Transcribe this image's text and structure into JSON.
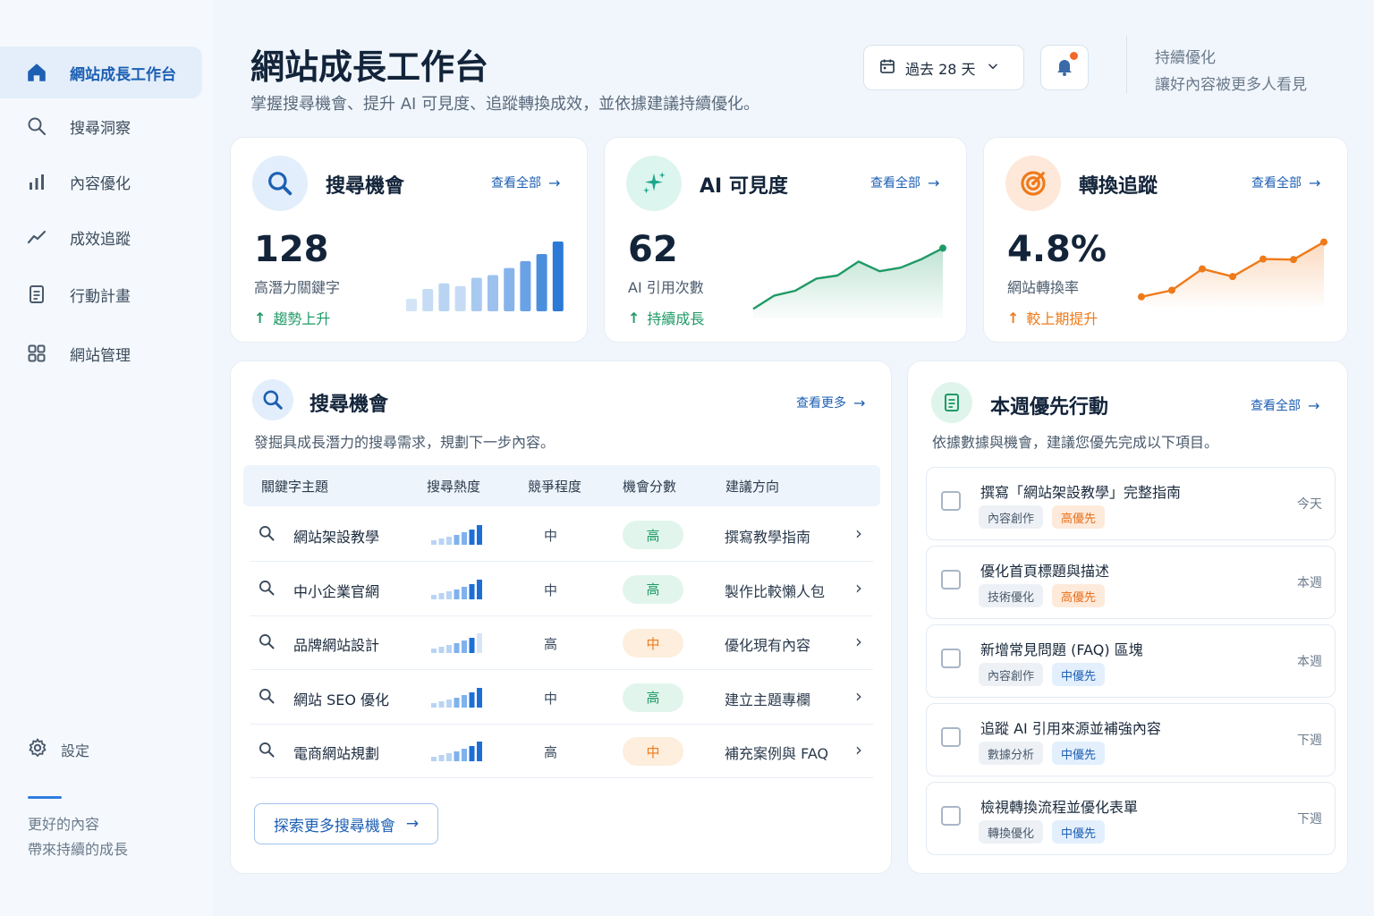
{
  "sidebar": {
    "items": [
      {
        "label": "網站成長工作台",
        "icon": "home-icon",
        "active": true
      },
      {
        "label": "搜尋洞察",
        "icon": "search-icon"
      },
      {
        "label": "內容優化",
        "icon": "bar-chart-icon"
      },
      {
        "label": "成效追蹤",
        "icon": "trend-line-icon"
      },
      {
        "label": "行動計畫",
        "icon": "document-icon"
      },
      {
        "label": "網站管理",
        "icon": "grid-icon"
      }
    ],
    "settings_label": "設定",
    "tagline_line1": "更好的內容",
    "tagline_line2": "帶來持續的成長"
  },
  "header": {
    "title": "網站成長工作台",
    "subtitle": "掌握搜尋機會、提升 AI 可見度、追蹤轉換成效，並依據建議持續優化。",
    "date_range": "過去 28 天",
    "note_line1": "持續優化",
    "note_line2": "讓好內容被更多人看見"
  },
  "colors": {
    "brand": "#1d5fb3",
    "accent_blue": "#2f7de0",
    "green": "#1f9a66",
    "orange": "#ef7a1a"
  },
  "kpis": [
    {
      "title": "搜尋機會",
      "view_all": "查看全部",
      "value": "128",
      "label": "高潛力關鍵字",
      "trend": "趨勢上升",
      "icon": "search-icon",
      "bars": [
        0.18,
        0.32,
        0.4,
        0.36,
        0.48,
        0.52,
        0.62,
        0.72,
        0.82,
        1.0
      ]
    },
    {
      "title": "AI 可見度",
      "view_all": "查看全部",
      "value": "62",
      "label": "AI 引用次數",
      "trend": "持續成長",
      "icon": "sparkle-icon",
      "series": [
        0.0,
        0.22,
        0.3,
        0.5,
        0.55,
        0.78,
        0.62,
        0.68,
        0.82,
        1.0
      ]
    },
    {
      "title": "轉換追蹤",
      "view_all": "查看全部",
      "value": "4.8%",
      "label": "網站轉換率",
      "trend": "較上期提升",
      "icon": "target-icon",
      "series": [
        0.0,
        0.12,
        0.51,
        0.37,
        0.69,
        0.68,
        1.0
      ]
    }
  ],
  "search": {
    "title": "搜尋機會",
    "view_more": "查看更多",
    "desc": "發掘具成長潛力的搜尋需求，規劃下一步內容。",
    "columns": [
      "關鍵字主題",
      "搜尋熱度",
      "競爭程度",
      "機會分數",
      "建議方向"
    ],
    "rows": [
      {
        "keyword": "網站架設教學",
        "heat": 5,
        "competition": "中",
        "score": "高",
        "score_level": "high",
        "suggestion": "撰寫教學指南"
      },
      {
        "keyword": "中小企業官網",
        "heat": 5,
        "competition": "中",
        "score": "高",
        "score_level": "high",
        "suggestion": "製作比較懶人包"
      },
      {
        "keyword": "品牌網站設計",
        "heat": 4,
        "competition": "高",
        "score": "中",
        "score_level": "mid",
        "suggestion": "優化現有內容"
      },
      {
        "keyword": "網站 SEO 優化",
        "heat": 5,
        "competition": "中",
        "score": "高",
        "score_level": "high",
        "suggestion": "建立主題專欄"
      },
      {
        "keyword": "電商網站規劃",
        "heat": 5,
        "competition": "高",
        "score": "中",
        "score_level": "mid",
        "suggestion": "補充案例與 FAQ"
      }
    ],
    "explore_label": "探索更多搜尋機會"
  },
  "actions": {
    "title": "本週優先行動",
    "view_all": "查看全部",
    "desc": "依據數據與機會，建議您優先完成以下項目。",
    "tasks": [
      {
        "title": "撰寫「網站架設教學」完整指南",
        "category": "內容創作",
        "priority": "高優先",
        "priority_level": "hi",
        "due": "今天"
      },
      {
        "title": "優化首頁標題與描述",
        "category": "技術優化",
        "priority": "高優先",
        "priority_level": "hi",
        "due": "本週"
      },
      {
        "title": "新增常見問題 (FAQ) 區塊",
        "category": "內容創作",
        "priority": "中優先",
        "priority_level": "md",
        "due": "本週"
      },
      {
        "title": "追蹤 AI 引用來源並補強內容",
        "category": "數據分析",
        "priority": "中優先",
        "priority_level": "md",
        "due": "下週"
      },
      {
        "title": "檢視轉換流程並優化表單",
        "category": "轉換優化",
        "priority": "中優先",
        "priority_level": "md",
        "due": "下週"
      }
    ]
  }
}
